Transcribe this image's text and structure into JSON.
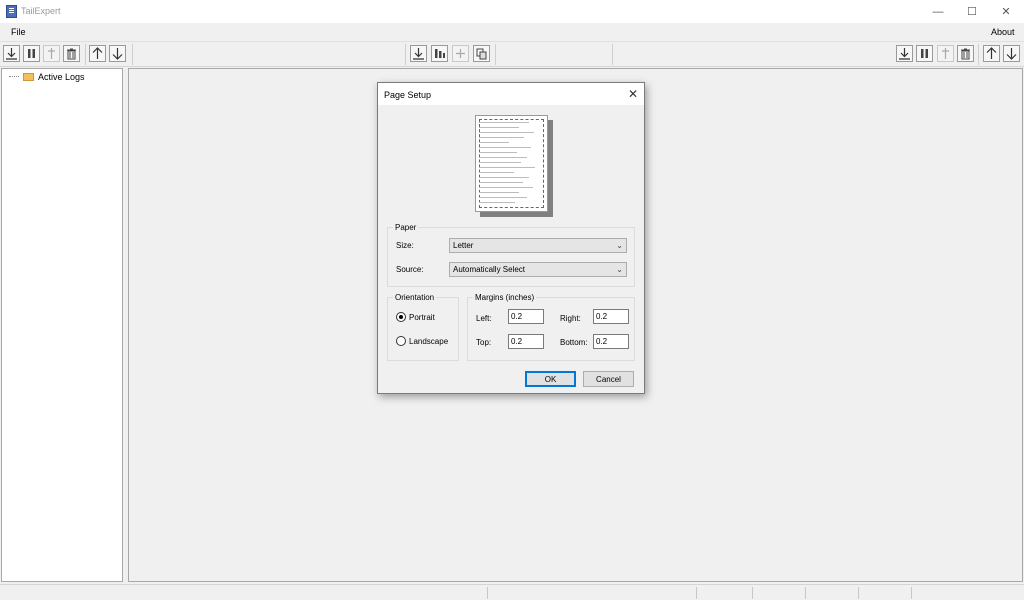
{
  "window": {
    "title": "TailExpert",
    "minimize": "—",
    "maximize": "☐",
    "close": "✕"
  },
  "menu": {
    "file": "File",
    "about": "About"
  },
  "tree": {
    "root": "Active Logs"
  },
  "dialog": {
    "title": "Page Setup",
    "close": "✕",
    "paper": {
      "legend": "Paper",
      "size_label": "Size:",
      "size_value": "Letter",
      "source_label": "Source:",
      "source_value": "Automatically Select"
    },
    "orientation": {
      "legend": "Orientation",
      "portrait": "Portrait",
      "landscape": "Landscape",
      "selected": "Portrait"
    },
    "margins": {
      "legend": "Margins (inches)",
      "left_label": "Left:",
      "left_value": "0.2",
      "right_label": "Right:",
      "right_value": "0.2",
      "top_label": "Top:",
      "top_value": "0.2",
      "bottom_label": "Bottom:",
      "bottom_value": "0.2"
    },
    "ok": "OK",
    "cancel": "Cancel"
  },
  "colors": {
    "accent": "#0078d7",
    "chrome": "#f0f0f0"
  }
}
